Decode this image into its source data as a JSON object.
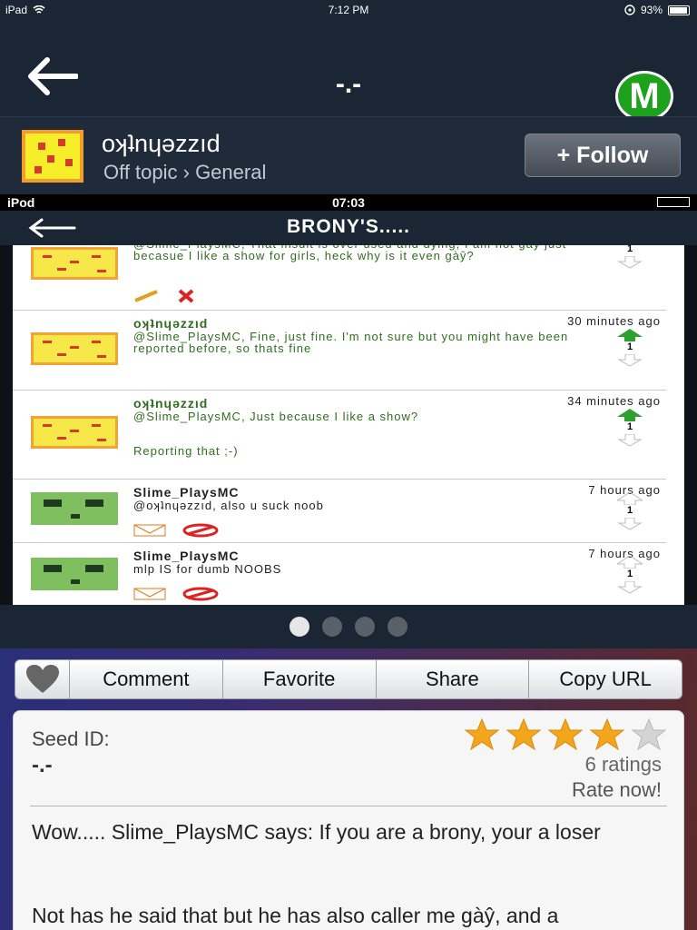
{
  "status_bar": {
    "device": "iPad",
    "time": "7:12 PM",
    "battery": "93%"
  },
  "nav": {
    "title": "-.-",
    "logo_letter": "M"
  },
  "author": {
    "name": "oʞʇnɥǝzzıd",
    "category": "Off topic › General",
    "follow_label": "+ Follow"
  },
  "screenshot": {
    "device": "iPod",
    "time": "07:03",
    "title": "BRONY'S.....",
    "comments": [
      {
        "name": "",
        "time": "",
        "text": "@Slime_PlaysMC, That insult is over used and dying, I am not gàŷ just becasue I like a show for girls, heck why is it even gàŷ?",
        "votes": "1"
      },
      {
        "name": "oʞʇnɥǝzzıd",
        "time": "30 minutes ago",
        "text": "@Slime_PlaysMC, Fine, just fine. I'm not sure but you might have been reported before, so thats fine",
        "votes": "1"
      },
      {
        "name": "oʞʇnɥǝzzıd",
        "time": "34 minutes ago",
        "text": "@Slime_PlaysMC, Just because I like a show?",
        "text2": "Reporting that ;-)",
        "votes": "1"
      },
      {
        "name": "Slime_PlaysMC",
        "time": "7 hours ago",
        "text": "@oʞʇnɥǝzzıd, also u suck noob",
        "votes": "1"
      },
      {
        "name": "Slime_PlaysMC",
        "time": "7 hours ago",
        "text": "mlp IS for dumb NOOBS",
        "votes": "1"
      }
    ]
  },
  "pager": {
    "count": 4,
    "active": 0
  },
  "toolbar": {
    "comment": "Comment",
    "favorite": "Favorite",
    "share": "Share",
    "copy_url": "Copy URL"
  },
  "seed": {
    "id_label": "Seed ID:",
    "id_value": "-.-",
    "stars_filled": 4,
    "stars_total": 5,
    "ratings": "6 ratings",
    "rate_now": "Rate now!",
    "body_line1": "Wow..... Slime_PlaysMC says: If you are a brony, your a loser",
    "body_line2": "Not has he said that but he has also caller me gàŷ, and a"
  },
  "colors": {
    "accent_green": "#1ea21e",
    "star": "#f3a51b",
    "nav_bg": "#1b2634"
  }
}
